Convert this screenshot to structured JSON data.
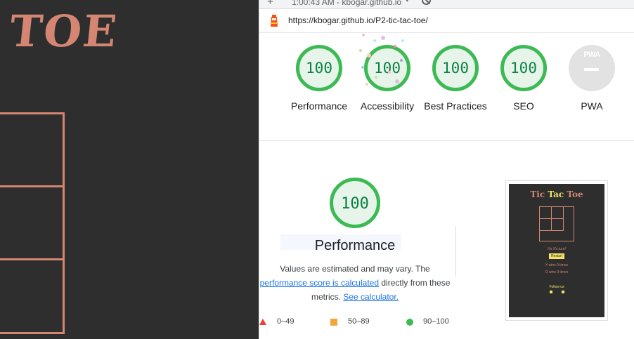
{
  "game": {
    "title": "TOE"
  },
  "browser": {
    "time_text": "1:00:43 AM - kbogar.github.io",
    "add_glyph": "+",
    "dropdown_glyph": "▾",
    "url": "https://kbogar.github.io/P2-tic-tac-toe/"
  },
  "gauges": [
    {
      "value": "100",
      "label": "Performance"
    },
    {
      "value": "100",
      "label": "Accessibility"
    },
    {
      "value": "100",
      "label": "Best Practices"
    },
    {
      "value": "100",
      "label": "SEO"
    },
    {
      "value": "PWA",
      "label": "PWA"
    }
  ],
  "performance": {
    "score": "100",
    "title": "Performance",
    "desc_text_1": "Values are estimated and may vary. The",
    "desc_link": "performance score is calculated",
    "desc_text_2": "directly from these metrics.",
    "desc_calc_link": "See calculator."
  },
  "legend": [
    {
      "range": "0–49",
      "color": "#eb4034",
      "shape": "triangle"
    },
    {
      "range": "50–89",
      "color": "#f2a53a",
      "shape": "square"
    },
    {
      "range": "90–100",
      "color": "#3cba54",
      "shape": "circle"
    }
  ],
  "thumbnail": {
    "title_a": "Tic",
    "title_b": "Tac",
    "title_c": "Toe",
    "turn_text": "It's X's turn!",
    "restart_label": "Restart",
    "x_wins": "X wins 0 times",
    "o_wins": "O wins 0 times",
    "follow_text": "Follow us"
  },
  "colors": {
    "game_bg": "#2e2e2e",
    "game_accent": "#d48672",
    "score_green": "#3cba54",
    "score_green_text": "#0b8043",
    "link_blue": "#1a73e8",
    "thumb_yellow": "#f4e26a"
  }
}
